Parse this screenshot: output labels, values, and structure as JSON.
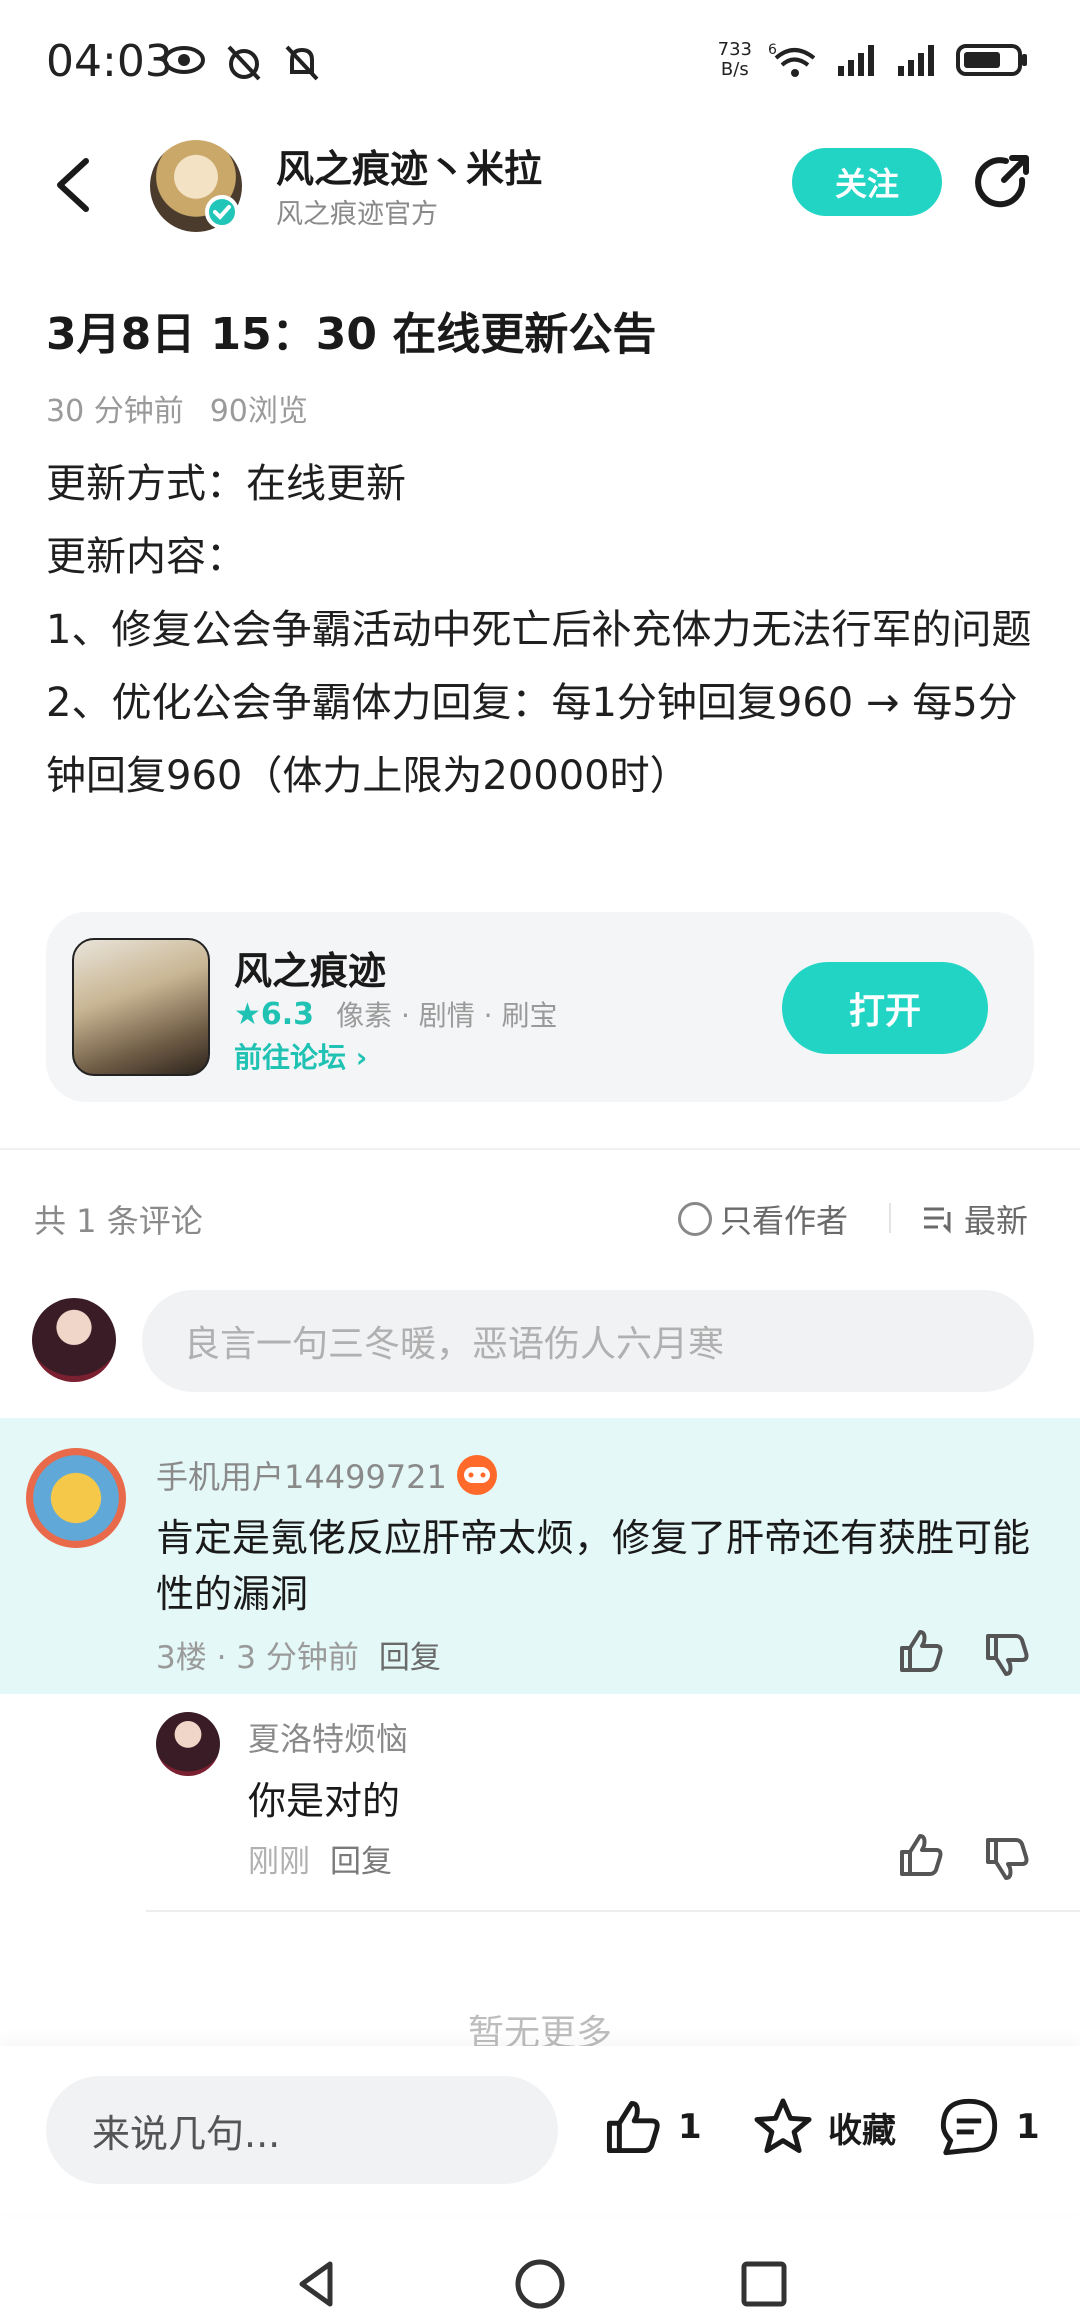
{
  "status_bar": {
    "time": "04:03",
    "net_speed_value": "733",
    "net_speed_unit": "B/s",
    "network_type": "6",
    "battery_level": 0.7
  },
  "header": {
    "author_name": "风之痕迹丶米拉",
    "author_subtitle": "风之痕迹官方",
    "follow_label": "关注"
  },
  "post": {
    "title": "3月8日 15：30 在线更新公告",
    "time_ago": "30 分钟前",
    "views": "90浏览",
    "body": [
      "更新方式：在线更新",
      "更新内容：",
      "1、修复公会争霸活动中死亡后补充体力无法行军的问题",
      "2、优化公会争霸体力回复：每1分钟回复960 → 每5分钟回复960（体力上限为20000时）"
    ]
  },
  "game_card": {
    "name": "风之痕迹",
    "rating": "6.3",
    "tags": "像素 · 剧情 · 刷宝",
    "forum_link": "前往论坛",
    "open_label": "打开"
  },
  "comments_header": {
    "count": "共 1 条评论",
    "author_only": "只看作者",
    "sort": "最新"
  },
  "comment_input": {
    "placeholder": "良言一句三冬暖，恶语伤人六月寒"
  },
  "comments": [
    {
      "user": "手机用户14499721",
      "text": "肯定是氪佬反应肝帝太烦，修复了肝帝还有获胜可能性的漏洞",
      "floor": "3楼 · 3 分钟前",
      "reply_label": "回复",
      "replies": [
        {
          "user": "夏洛特烦恼",
          "text": "你是对的",
          "time": "刚刚",
          "reply_label": "回复"
        }
      ]
    }
  ],
  "no_more": "暂无更多",
  "bottom_bar": {
    "input_placeholder": "来说几句...",
    "like_count": "1",
    "favorite_label": "收藏",
    "comment_count": "1"
  },
  "colors": {
    "accent": "#22d4c4",
    "highlight_bg": "#e4f8f7"
  }
}
